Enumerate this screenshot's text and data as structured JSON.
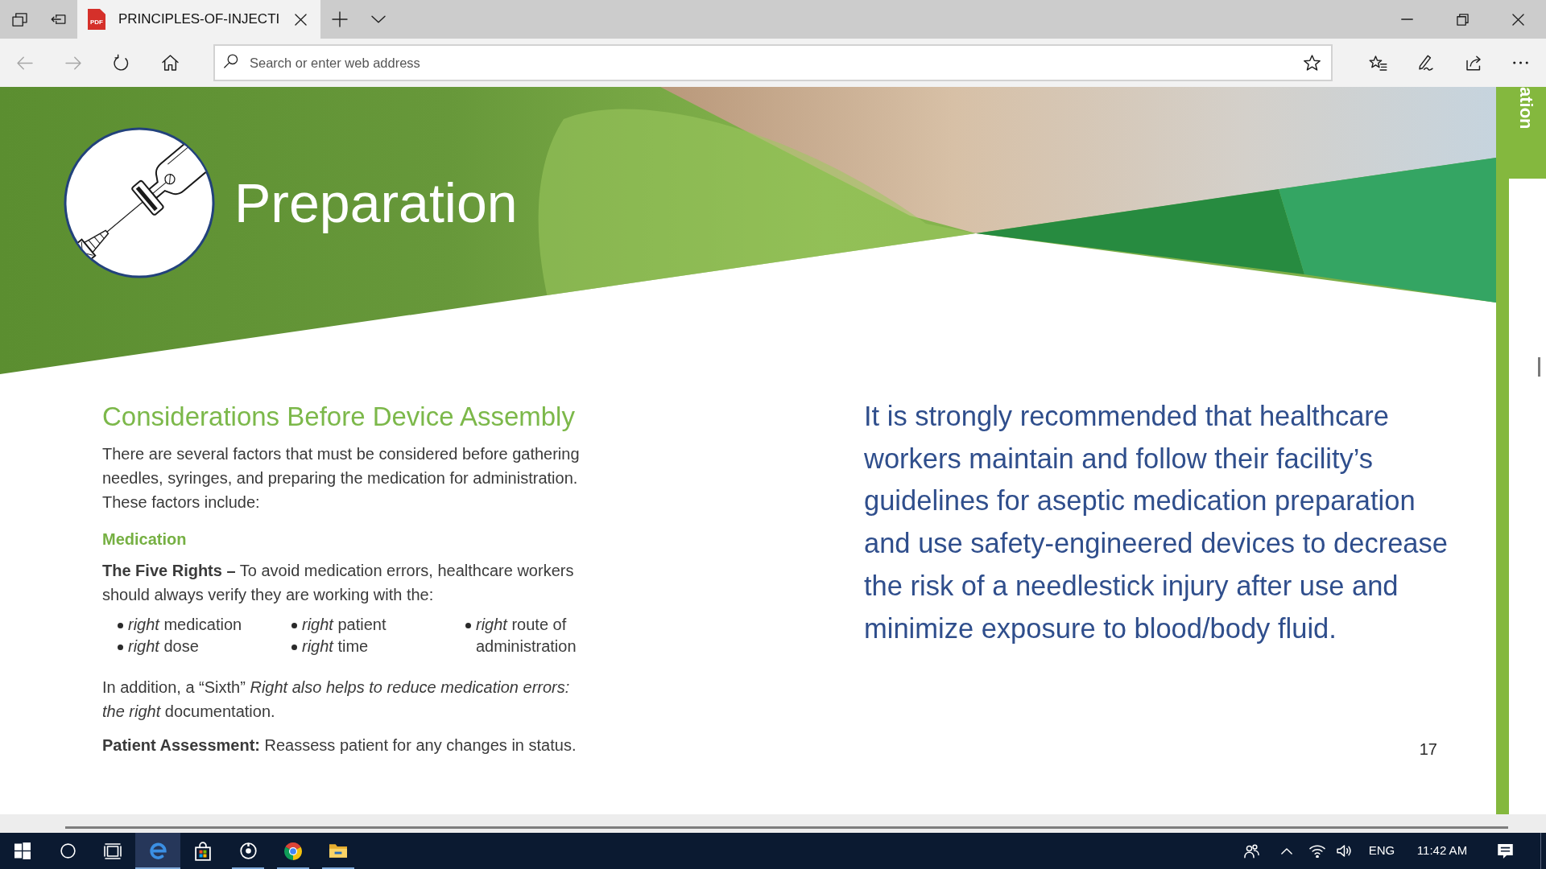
{
  "browser": {
    "tab_strip_buttons": [
      {
        "kind": "tab-preview"
      },
      {
        "kind": "set-aside"
      }
    ],
    "tabs": [
      {
        "icon_label": "PDF",
        "title": "PRINCIPLES-OF-INJECTI",
        "selected": true
      }
    ],
    "tab_actions": [
      {
        "kind": "new-tab"
      },
      {
        "kind": "tab-list"
      }
    ],
    "window_controls": [
      {
        "kind": "minimize"
      },
      {
        "kind": "restore"
      },
      {
        "kind": "close"
      }
    ],
    "nav_buttons": [
      {
        "kind": "back",
        "disabled": true
      },
      {
        "kind": "forward",
        "disabled": true
      },
      {
        "kind": "refresh",
        "disabled": false
      },
      {
        "kind": "home",
        "disabled": false
      }
    ],
    "address_bar": {
      "placeholder": "Search or enter web address"
    },
    "toolbar_buttons": [
      {
        "kind": "favorites"
      },
      {
        "kind": "notes"
      },
      {
        "kind": "share"
      },
      {
        "kind": "more"
      }
    ]
  },
  "document": {
    "banner": {
      "title": "Preparation"
    },
    "heading": "Considerations Before Device Assembly",
    "intro": "There are several factors that must be considered before gathering needles, syringes, and preparing the medication for administration. These factors include:",
    "subheading": "Medication",
    "five_rights": "**The Five Rights –** To avoid medication errors, healthcare workers should always verify they are working with the:",
    "rights_columns": [
      [
        "*right* medication",
        "*right* dose"
      ],
      [
        "*right* patient",
        "*right* time"
      ],
      [
        "*right* route of administration"
      ]
    ],
    "sixth_right": "In addition, a “Sixth” *Right also helps to reduce medication errors: the right* documentation.",
    "assessment": "**Patient Assessment:** Reassess patient for any changes in status.",
    "callout": "It is strongly recommended that healthcare workers maintain and follow their facility’s guidelines for aseptic medication preparation and use safety-engineered devices to decrease the risk of a needlestick injury after use and minimize exposure to blood/body fluid.",
    "page_number": "17",
    "section_tab": "ation"
  },
  "taskbar": {
    "system_buttons": [
      {
        "kind": "start"
      },
      {
        "kind": "search"
      },
      {
        "kind": "task-view"
      }
    ],
    "apps": [
      {
        "kind": "edge",
        "running": true,
        "selected": true
      },
      {
        "kind": "store",
        "running": false,
        "selected": false
      },
      {
        "kind": "ring",
        "running": true,
        "selected": false
      },
      {
        "kind": "chrome",
        "running": true,
        "selected": false
      },
      {
        "kind": "explorer",
        "running": true,
        "selected": false
      }
    ],
    "tray": [
      {
        "kind": "people"
      },
      {
        "kind": "chevron"
      },
      {
        "kind": "network"
      },
      {
        "kind": "volume"
      }
    ],
    "language": "ENG",
    "time": "11:42 AM"
  }
}
